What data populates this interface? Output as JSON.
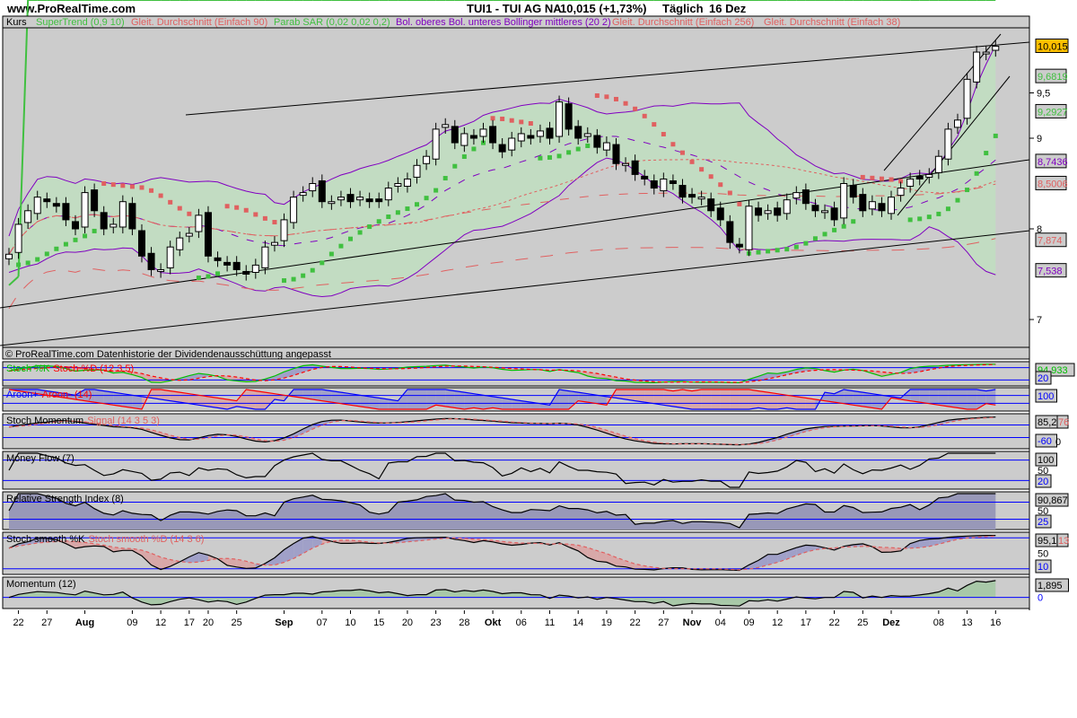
{
  "header": {
    "site": "www.ProRealTime.com",
    "title": "TUI1 - TUI AG NA",
    "price_change": "10,015 (+1,73%)",
    "period": "Täglich",
    "date": "16 Dez"
  },
  "legend": {
    "kurs": "Kurs",
    "supertrend": "SuperTrend (0,9 10)",
    "ma90": "Gleit. Durchschnitt (Einfach 90)",
    "sar": "Parab SAR (0,02 0,02 0,2)",
    "bollinger": "Bol. oberes Bol. unteres Bollinger mittleres (20 2)",
    "ma256": "Gleit. Durchschnitt (Einfach 256)",
    "ma38": "Gleit. Durchschnitt (Einfach 38)"
  },
  "footer_note": "© ProRealTime.com  Datenhistorie der Dividendenausschüttung angepasst",
  "price_axis": {
    "ticks": [
      {
        "value": 9.5,
        "label": "9,5"
      },
      {
        "value": 9,
        "label": "9"
      },
      {
        "value": 8,
        "label": "8"
      },
      {
        "value": 7,
        "label": "7"
      }
    ],
    "badges": [
      {
        "value": 10.015,
        "label": "10,015",
        "color": "#000000",
        "bg": "#ffc000"
      },
      {
        "value": 9.6819,
        "label": "9,6819",
        "color": "#40c040",
        "bg": "#cccccc"
      },
      {
        "value": 9.2927,
        "label": "9,2927",
        "color": "#40c040",
        "bg": "#cccccc"
      },
      {
        "value": 8.7436,
        "label": "8,7436",
        "color": "#8000c0",
        "bg": "#cccccc"
      },
      {
        "value": 8.5006,
        "label": "8,5006",
        "color": "#e06060",
        "bg": "#cccccc"
      },
      {
        "value": 7.874,
        "label": "7,874",
        "color": "#e06060",
        "bg": "#cccccc"
      },
      {
        "value": 7.538,
        "label": "7,538",
        "color": "#8000c0",
        "bg": "#cccccc"
      }
    ]
  },
  "panels": {
    "stoch": {
      "title_a": "Stoch %K",
      "title_b": "Stoch %D (12 3 5)",
      "value": "94,933",
      "low": "20"
    },
    "aroon": {
      "title_a": "Aroon+",
      "title_b": "Aroon- (14)",
      "value": "100"
    },
    "stochmom": {
      "title_a": "Stoch Momentum",
      "title_b": "Signal (14 3 5 3)",
      "value": "85,2",
      "value2": "76",
      "zero": "0",
      "low": "-60"
    },
    "mf": {
      "title_a": "Money Flow (7)",
      "value": "100",
      "mid": "50",
      "low": "20"
    },
    "rsi": {
      "title_a": "Relative Strength Index (8)",
      "value": "90,867",
      "mid": "50",
      "low": "25"
    },
    "stochsmooth": {
      "title_a": "Stoch smooth %K",
      "title_b": "Stoch smooth %D (14 3 6)",
      "value": "95,1",
      "value2": "13",
      "mid": "50",
      "low": "10"
    },
    "momentum": {
      "title_a": "Momentum (12)",
      "value": "1,895",
      "zero": "0"
    }
  },
  "chart_data": {
    "type": "candlestick",
    "title": "TUI1 - TUI AG NA",
    "ylim": [
      6.7,
      10.15
    ],
    "close": [
      7.72,
      8.05,
      8.2,
      8.35,
      8.3,
      8.25,
      8.1,
      8.0,
      8.4,
      8.2,
      8.0,
      8.05,
      8.3,
      8.0,
      7.7,
      7.55,
      7.55,
      7.8,
      7.9,
      7.95,
      8.15,
      7.7,
      7.65,
      7.6,
      7.55,
      7.5,
      7.6,
      7.8,
      7.85,
      8.1,
      8.35,
      8.4,
      8.5,
      8.3,
      8.3,
      8.35,
      8.3,
      8.35,
      8.3,
      8.3,
      8.45,
      8.5,
      8.55,
      8.7,
      8.8,
      9.1,
      9.15,
      8.95,
      9.05,
      9.0,
      9.1,
      8.95,
      8.85,
      9.0,
      9.05,
      9.0,
      9.08,
      9.0,
      9.4,
      9.1,
      9.0,
      9.05,
      8.9,
      8.95,
      8.72,
      8.72,
      8.6,
      8.55,
      8.45,
      8.55,
      8.5,
      8.35,
      8.35,
      8.35,
      8.2,
      8.1,
      7.85,
      7.8,
      8.25,
      8.15,
      8.2,
      8.15,
      8.32,
      8.4,
      8.28,
      8.2,
      8.2,
      8.1,
      8.5,
      8.35,
      8.2,
      8.3,
      8.2,
      8.35,
      8.45,
      8.55,
      8.55,
      8.6,
      8.8,
      9.1,
      9.2,
      9.65,
      9.95,
      9.95,
      10.015
    ],
    "x_labels": [
      {
        "idx": 1,
        "label": "22"
      },
      {
        "idx": 4,
        "label": "27"
      },
      {
        "idx": 8,
        "label": "Aug",
        "month": true
      },
      {
        "idx": 13,
        "label": "09"
      },
      {
        "idx": 16,
        "label": "12"
      },
      {
        "idx": 19,
        "label": "17"
      },
      {
        "idx": 21,
        "label": "20"
      },
      {
        "idx": 24,
        "label": "25"
      },
      {
        "idx": 29,
        "label": "Sep",
        "month": true
      },
      {
        "idx": 33,
        "label": "07"
      },
      {
        "idx": 36,
        "label": "10"
      },
      {
        "idx": 39,
        "label": "15"
      },
      {
        "idx": 42,
        "label": "20"
      },
      {
        "idx": 45,
        "label": "23"
      },
      {
        "idx": 48,
        "label": "28"
      },
      {
        "idx": 51,
        "label": "Okt",
        "month": true
      },
      {
        "idx": 54,
        "label": "06"
      },
      {
        "idx": 57,
        "label": "11"
      },
      {
        "idx": 60,
        "label": "14"
      },
      {
        "idx": 63,
        "label": "19"
      },
      {
        "idx": 66,
        "label": "22"
      },
      {
        "idx": 69,
        "label": "27"
      },
      {
        "idx": 72,
        "label": "Nov",
        "month": true
      },
      {
        "idx": 75,
        "label": "04"
      },
      {
        "idx": 78,
        "label": "09"
      },
      {
        "idx": 81,
        "label": "12"
      },
      {
        "idx": 84,
        "label": "17"
      },
      {
        "idx": 87,
        "label": "22"
      },
      {
        "idx": 90,
        "label": "25"
      },
      {
        "idx": 93,
        "label": "Dez",
        "month": true
      },
      {
        "idx": 98,
        "label": "08"
      },
      {
        "idx": 101,
        "label": "13"
      },
      {
        "idx": 104,
        "label": "16"
      }
    ],
    "colors": {
      "up": "#ffffff",
      "down": "#000000",
      "supertrend": "#40c040",
      "ma": "#e06060",
      "sar_up": "#40c040",
      "sar_down": "#e06060",
      "bollinger": "#8000c0",
      "band_fill": "#c2dcc2",
      "level": "#0000ff"
    }
  }
}
